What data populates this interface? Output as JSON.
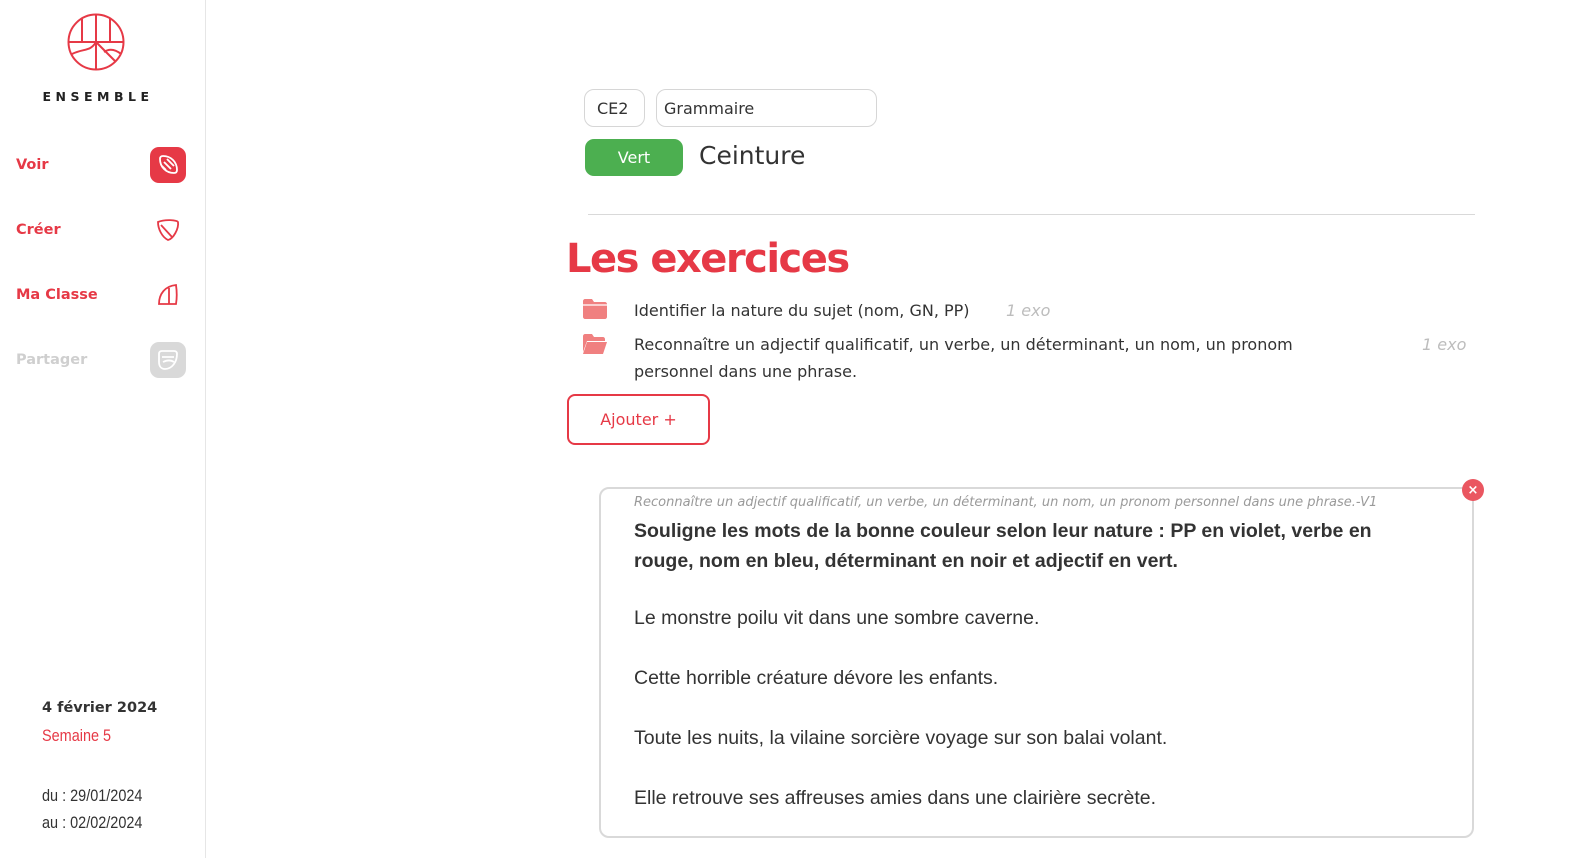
{
  "brand": {
    "name": "ENSEMBLE"
  },
  "nav": [
    {
      "label": "Voir",
      "icon": "leaf-book-icon",
      "state": "active"
    },
    {
      "label": "Créer",
      "icon": "leaf-pencil-icon",
      "state": "normal"
    },
    {
      "label": "Ma Classe",
      "icon": "half-leaf-icon",
      "state": "normal"
    },
    {
      "label": "Partager",
      "icon": "leaf-share-icon",
      "state": "disabled"
    }
  ],
  "calendar": {
    "date": "4 février 2024",
    "week": "Semaine 5",
    "from": "du : 29/01/2024",
    "to": "au : 02/02/2024"
  },
  "filters": {
    "level": "CE2",
    "domain": "Grammaire",
    "belt_color": "Vert",
    "belt_label": "Ceinture"
  },
  "exercises": {
    "title": "Les exercices",
    "items": [
      {
        "text": "Identifier la nature du sujet (nom, GN, PP)",
        "count": "1 exo",
        "folder": "closed"
      },
      {
        "text": "Reconnaître un adjectif qualificatif, un verbe, un déterminant, un nom, un pronom personnel dans une phrase.",
        "count": "1 exo",
        "folder": "open"
      }
    ],
    "add_label": "Ajouter +"
  },
  "card": {
    "reference": "Reconnaître un adjectif qualificatif, un verbe, un déterminant, un nom, un pronom personnel dans une phrase.-V1",
    "instruction": "Souligne les mots de la bonne couleur selon leur nature : PP en violet, verbe en rouge, nom en bleu, déterminant en noir et adjectif en vert.",
    "sentences": [
      "Le monstre poilu vit dans une sombre caverne.",
      "Cette horrible créature dévore les enfants.",
      "Toute les nuits, la vilaine sorcière voyage sur son balai volant.",
      "Elle retrouve ses affreuses amies dans une clairière secrète."
    ],
    "close": "×"
  },
  "colors": {
    "accent": "#e63946",
    "belt_green": "#4caf50",
    "disabled": "#cfcfcf",
    "folder": "#f08080"
  }
}
